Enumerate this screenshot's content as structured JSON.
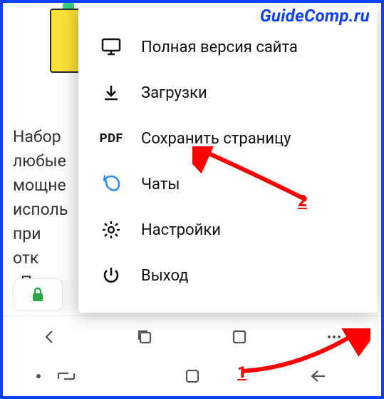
{
  "watermark": "GuideComp.ru",
  "bg_text": "Набор\nлюбые\nмощне\nисполь\nпри отк\n«Пане",
  "menu": {
    "items": [
      {
        "id": "desktop-site",
        "label": "Полная версия сайта"
      },
      {
        "id": "downloads",
        "label": "Загрузки"
      },
      {
        "id": "save-page",
        "label": "Сохранить страницу"
      },
      {
        "id": "chats",
        "label": "Чаты"
      },
      {
        "id": "settings",
        "label": "Настройки"
      },
      {
        "id": "exit",
        "label": "Выход"
      }
    ]
  },
  "annotations": {
    "arrow1_label": "1",
    "arrow2_label": "2"
  },
  "colors": {
    "frame": "#1040ff",
    "arrow": "#ff0000",
    "lock": "#27a844"
  }
}
